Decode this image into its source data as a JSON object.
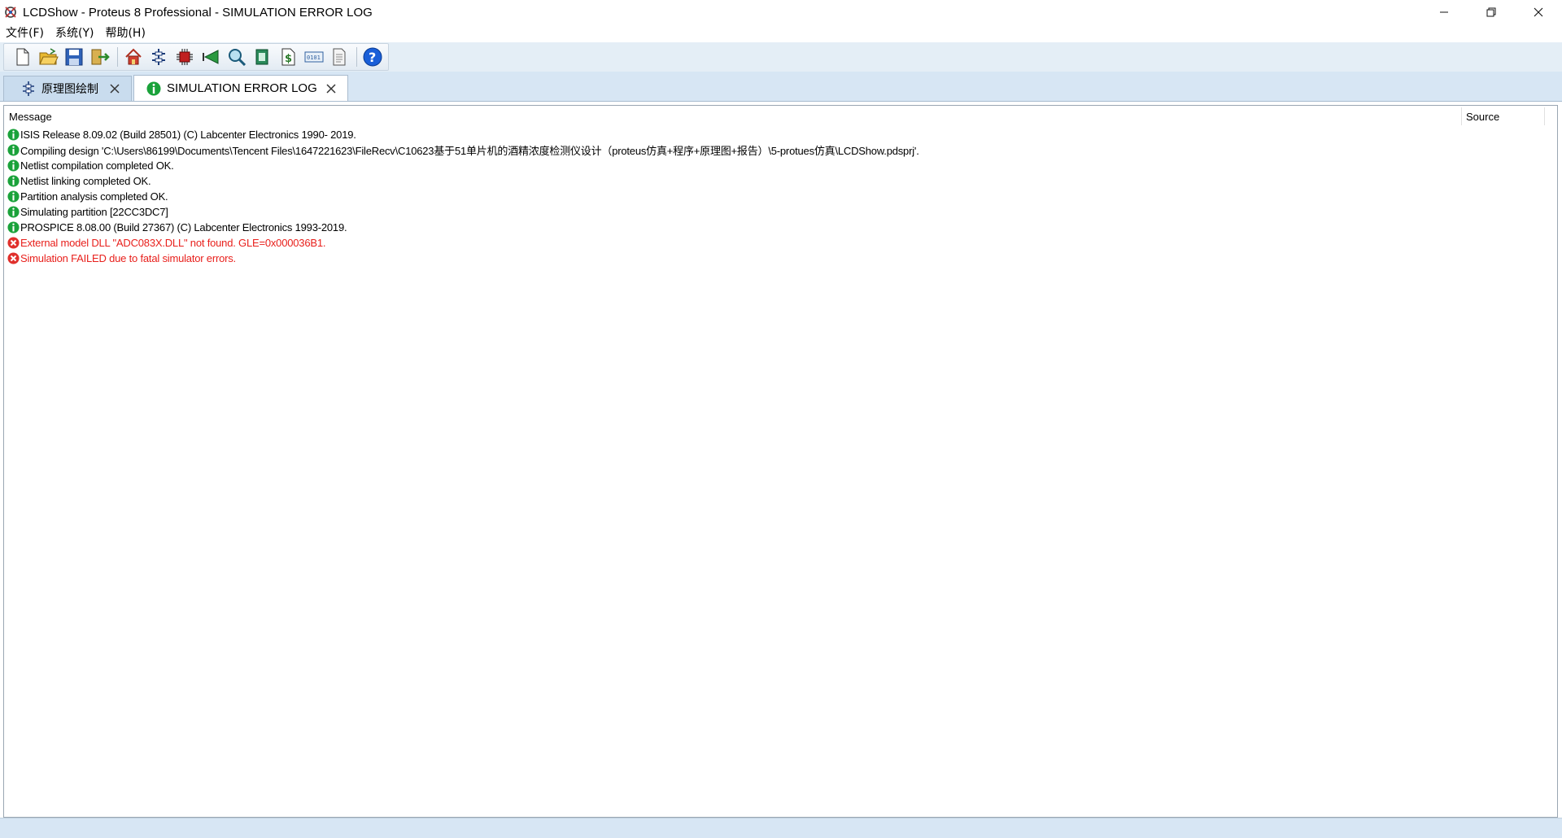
{
  "window": {
    "title": "LCDShow - Proteus 8 Professional - SIMULATION ERROR LOG",
    "controls": {
      "minimize": "—",
      "restore": "❐",
      "close": "✕"
    }
  },
  "menu": [
    "文件(F)",
    "系统(Y)",
    "帮助(H)"
  ],
  "toolbar": {
    "buttons": [
      "new-project-icon",
      "open-project-icon",
      "save-project-icon",
      "close-project-icon",
      "home-icon",
      "schematic-capture-icon",
      "pcb-layout-icon",
      "simulation-graph-icon",
      "design-explorer-icon",
      "bill-of-materials-icon",
      "cost-icon",
      "source-code-icon",
      "notes-icon",
      "help-icon"
    ]
  },
  "tabs": [
    {
      "label": "原理图绘制",
      "icon": "schematic-icon",
      "active": false
    },
    {
      "label": "SIMULATION ERROR LOG",
      "icon": "info-icon",
      "active": true
    }
  ],
  "log": {
    "columns": {
      "message": "Message",
      "source": "Source"
    },
    "rows": [
      {
        "type": "info",
        "text": "ISIS Release 8.09.02 (Build 28501) (C) Labcenter Electronics 1990- 2019."
      },
      {
        "type": "info",
        "text": "Compiling design 'C:\\Users\\86199\\Documents\\Tencent Files\\1647221623\\FileRecv\\C10623基于51单片机的酒精浓度检测仪设计（proteus仿真+程序+原理图+报告）\\5-protues仿真\\LCDShow.pdsprj'."
      },
      {
        "type": "info",
        "text": "Netlist compilation completed OK."
      },
      {
        "type": "info",
        "text": "Netlist linking completed OK."
      },
      {
        "type": "info",
        "text": "Partition analysis completed OK."
      },
      {
        "type": "info",
        "text": "Simulating partition [22CC3DC7]"
      },
      {
        "type": "info",
        "text": "PROSPICE 8.08.00 (Build 27367) (C) Labcenter Electronics 1993-2019."
      },
      {
        "type": "error",
        "text": "External model DLL \"ADC083X.DLL\" not found. GLE=0x000036B1."
      },
      {
        "type": "error",
        "text": "Simulation FAILED due to fatal simulator errors."
      }
    ]
  },
  "colors": {
    "error_text": "#e8201c",
    "info_icon": "#1aa23a",
    "error_icon": "#e0302c",
    "tabstrip_bg": "#d7e6f4"
  }
}
